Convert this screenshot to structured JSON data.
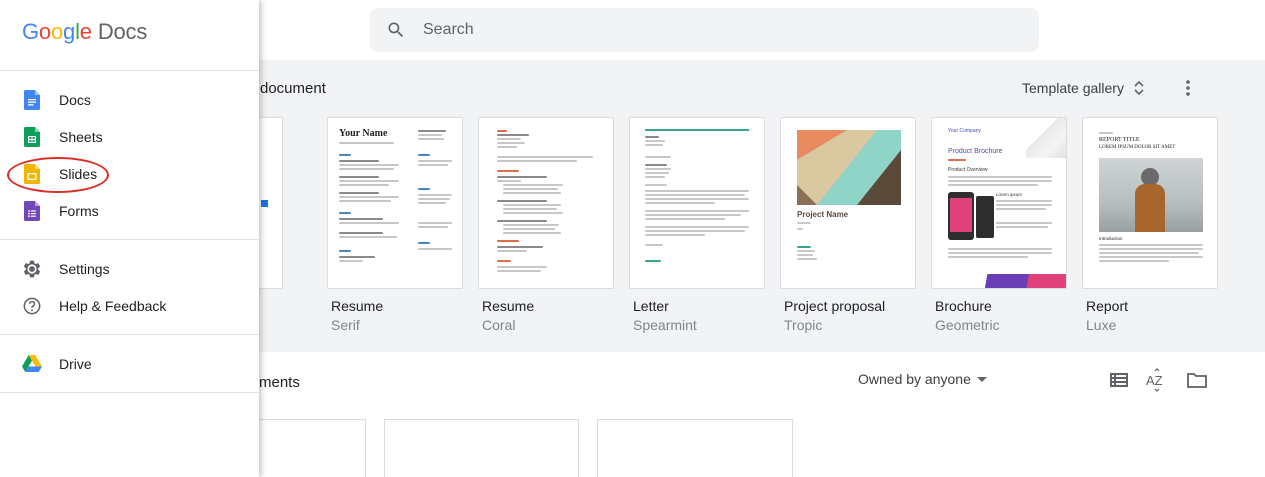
{
  "search": {
    "placeholder": "Search"
  },
  "start": {
    "title": "document",
    "gallery_label": "Template gallery",
    "templates": [
      {
        "name": "Resume",
        "style": "Serif"
      },
      {
        "name": "Resume",
        "style": "Coral"
      },
      {
        "name": "Letter",
        "style": "Spearmint"
      },
      {
        "name": "Project proposal",
        "style": "Tropic"
      },
      {
        "name": "Brochure",
        "style": "Geometric"
      },
      {
        "name": "Report",
        "style": "Luxe"
      }
    ],
    "thumb_text": {
      "serif_name": "Your Name",
      "proposal_title": "Project Name",
      "brochure_company": "Your Company",
      "brochure_title": "Product Brochure",
      "brochure_overview": "Product Overview",
      "brochure_lorem": "Lorem ipsum",
      "report_label": "REPORT TITLE",
      "report_sub": "LOREM IPSUM DOLOR SIT AMET",
      "report_intro": "Introduction"
    }
  },
  "recent": {
    "title": "ments",
    "owner_filter": "Owned by anyone"
  },
  "drawer": {
    "brand": {
      "g1": "G",
      "g2": "o",
      "g3": "o",
      "g4": "g",
      "g5": "l",
      "g6": "e",
      "product": "Docs"
    },
    "apps": [
      {
        "label": "Docs",
        "icon": "docs-icon",
        "color": "#4285f4"
      },
      {
        "label": "Sheets",
        "icon": "sheets-icon",
        "color": "#0f9d58"
      },
      {
        "label": "Slides",
        "icon": "slides-icon",
        "color": "#f4b400"
      },
      {
        "label": "Forms",
        "icon": "forms-icon",
        "color": "#7248b9"
      }
    ],
    "settings": [
      {
        "label": "Settings",
        "icon": "gear-icon"
      },
      {
        "label": "Help & Feedback",
        "icon": "help-icon"
      }
    ],
    "drive": {
      "label": "Drive",
      "icon": "drive-icon"
    }
  },
  "colors": {
    "accent": "#1a73e8",
    "highlight": "#d93025",
    "section_bg": "#f1f3f4"
  }
}
